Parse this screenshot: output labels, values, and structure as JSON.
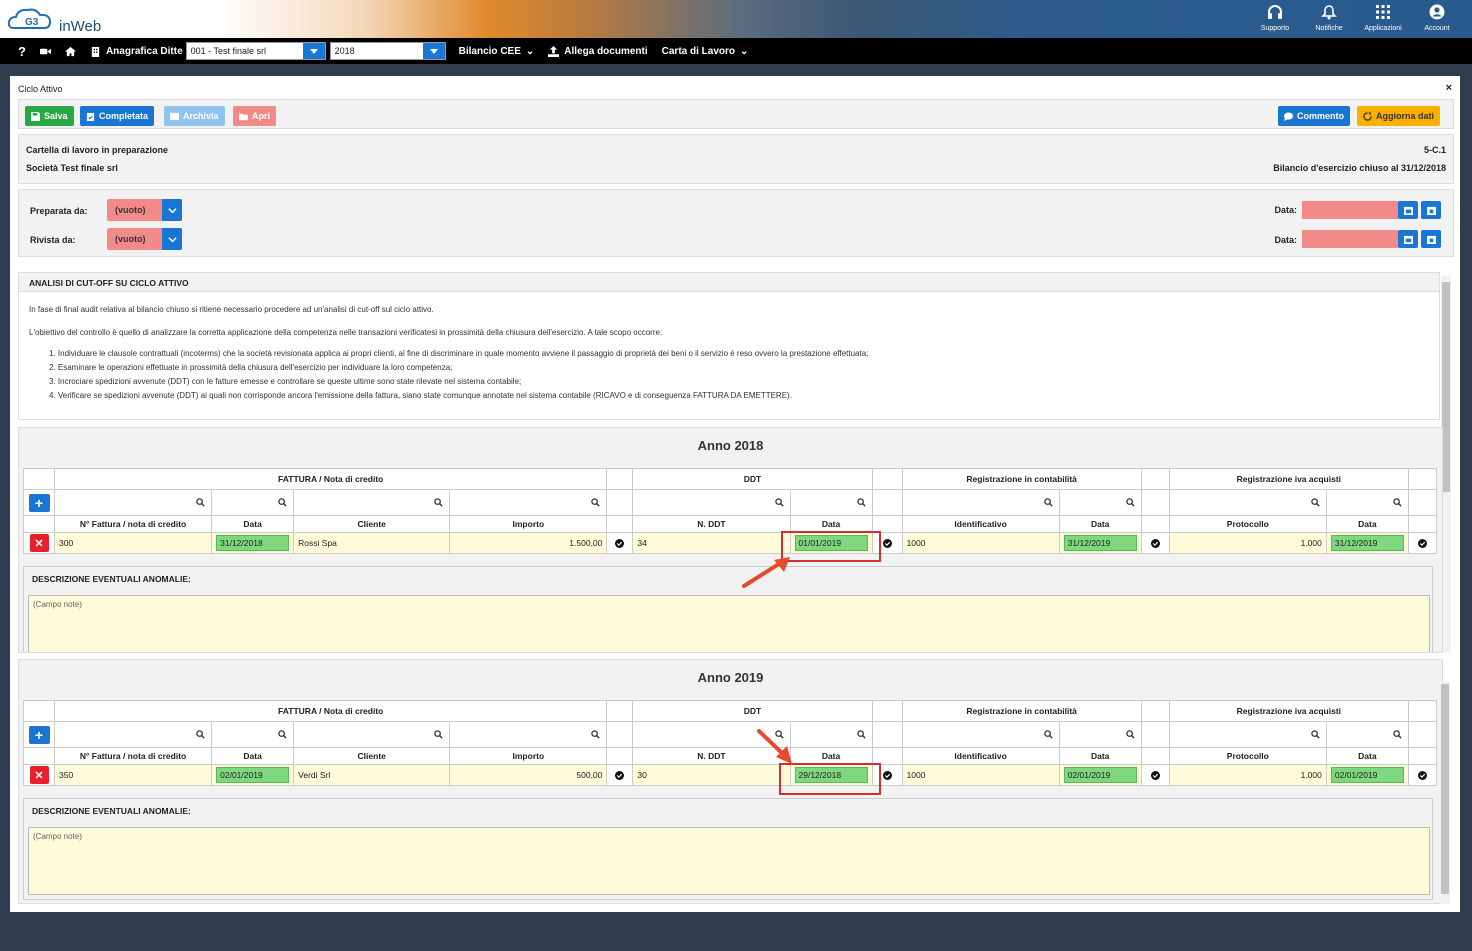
{
  "app": {
    "logo_text": "inWeb",
    "top_icons": [
      {
        "icon": "headphones-icon",
        "label": "Supporto"
      },
      {
        "icon": "bell-icon",
        "label": "Notifiche"
      },
      {
        "icon": "grid-icon",
        "label": "Applicazioni"
      },
      {
        "icon": "account-icon",
        "label": "Account"
      }
    ]
  },
  "nav": {
    "anagrafica_label": "Anagrafica Ditte",
    "ditta_value": "001 - Test finale srl",
    "year_value": "2018",
    "bilancio_label": "Bilancio CEE",
    "allega_label": "Allega documenti",
    "carta_label": "Carta di Lavoro"
  },
  "panel": {
    "title": "Ciclo Attivo",
    "close": "×"
  },
  "toolbar": {
    "salva": "Salva",
    "completata": "Completata",
    "archivia": "Archivia",
    "apri": "Apri",
    "commento": "Commento",
    "aggiorna": "Aggiorna dati"
  },
  "info": {
    "stato": "Cartella di lavoro in preparazione",
    "societa": "Società Test finale srl",
    "codice": "5-C.1",
    "bilancio": "Bilancio d'esercizio chiuso al 31/12/2018"
  },
  "prep": {
    "preparata_label": "Preparata da:",
    "rivista_label": "Rivista da:",
    "preparata_value": "(vuoto)",
    "rivista_value": "(vuoto)",
    "data_label": "Data:"
  },
  "analisi": {
    "header": "ANALISI DI CUT-OFF SU CICLO ATTIVO",
    "p1": "In fase di final audit relativa al bilancio chiuso si ritiene necessario procedere ad un'analisi di cut-off sul ciclo attivo.",
    "p2": "L'obiettivo del controllo è quello di analizzare la corretta applicazione della competenza nelle transazioni verificatesi in prossimità della chiusura dell'esercizio. A tale scopo occorre:",
    "items": [
      "1. Individuare le clausole contrattuali (incoterms) che la società revisionata applica ai propri clienti, al fine di discriminare in quale momento avviene il passaggio di proprietà dei beni o il servizio è reso ovvero la prestazione effettuata;",
      "2. Esaminare le operazioni effettuate in prossimità della chiusura dell'esercizio per individuare la loro competenza;",
      "3. Incrociare spedizioni avvenute (DDT) con le fatture emesse e controllare se queste ultime sono state rilevate nel sistema contabile;",
      "4. Verificare se spedizioni avvenute (DDT) ai quali non corrisponde ancora l'emissione della fattura, siano state comunque annotate nel sistema contabile (RICAVO e di conseguenza FATTURA DA EMETTERE)."
    ]
  },
  "groups": {
    "fattura": "FATTURA / Nota di credito",
    "ddt": "DDT",
    "reg": "Registrazione in contabilità",
    "iva": "Registrazione iva acquisti"
  },
  "cols": {
    "nfatt": "N° Fattura / nota di credito",
    "data": "Data",
    "cliente": "Cliente",
    "importo": "Importo",
    "nddt": "N. DDT",
    "ident": "Identificativo",
    "protocollo": "Protocollo"
  },
  "anomalie_label": "DESCRIZIONE EVENTUALI ANOMALIE:",
  "notes_placeholder": "(Campo note)",
  "years": [
    {
      "title": "Anno 2018",
      "row": {
        "nfatt": "300",
        "data": "31/12/2018",
        "cliente": "Rossi Spa",
        "importo": "1.500,00",
        "nddt": "34",
        "ddt_data": "01/01/2019",
        "ident": "1000",
        "reg_data": "31/12/2019",
        "protocollo": "1.000",
        "iva_data": "31/12/2019"
      }
    },
    {
      "title": "Anno 2019",
      "row": {
        "nfatt": "350",
        "data": "02/01/2019",
        "cliente": "Verdi Srl",
        "importo": "500,00",
        "nddt": "30",
        "ddt_data": "29/12/2018",
        "ident": "1000",
        "reg_data": "02/01/2019",
        "protocollo": "1.000",
        "iva_data": "02/01/2019"
      }
    }
  ],
  "colors": {
    "primary": "#1976d2",
    "success": "#28a745",
    "danger": "#e8202a",
    "warning": "#f9b000",
    "highlight": "#d32f2f"
  }
}
